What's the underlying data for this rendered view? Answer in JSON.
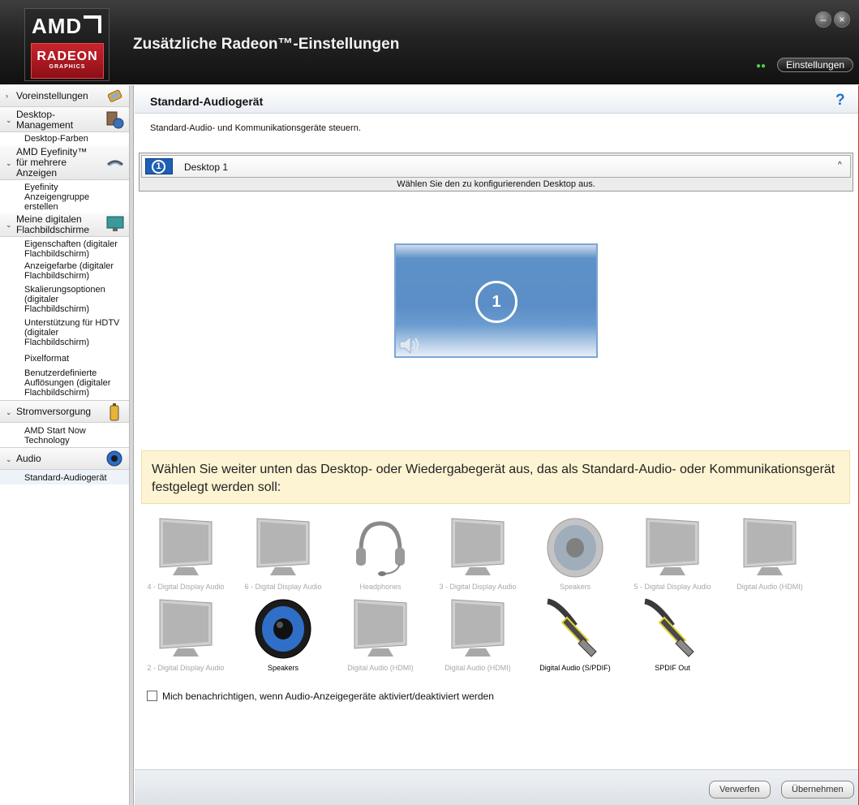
{
  "header": {
    "logo": {
      "brand": "AMD",
      "product": "RADEON",
      "subtitle": "GRAPHICS"
    },
    "title": "Zusätzliche Radeon™-Einstellungen",
    "minimize_icon": "–",
    "close_icon": "×",
    "settings_button": "Einstellungen",
    "status_led_icon": "●●"
  },
  "sidebar": {
    "sections": [
      {
        "label": "Voreinstellungen",
        "chevron": "›",
        "icon": "wrench-icon"
      },
      {
        "label": "Desktop-\nManagement",
        "chevron": "⌄",
        "icon": "monitor-gear-icon",
        "items": [
          "Desktop-Farben"
        ]
      },
      {
        "label": "AMD Eyefinity™\nfür mehrere\nAnzeigen",
        "chevron": "⌄",
        "icon": "eyefinity-icon",
        "items": [
          "Eyefinity\nAnzeigengruppe\nerstellen"
        ]
      },
      {
        "label": "Meine digitalen\nFlachbildschirme",
        "chevron": "⌄",
        "icon": "flatpanel-icon",
        "items": [
          "Eigenschaften (digitaler\nFlachbildschirm)",
          "Anzeigefarbe (digitaler\nFlachbildschirm)",
          "Skalierungsoptionen\n(digitaler\nFlachbildschirm)",
          "Unterstützung für HDTV\n(digitaler\nFlachbildschirm)",
          "Pixelformat",
          "Benutzerdefinierte\nAuflösungen (digitaler\nFlachbildschirm)"
        ]
      },
      {
        "label": "Stromversorgung",
        "chevron": "⌄",
        "icon": "battery-icon",
        "items": [
          "AMD Start Now\nTechnology"
        ]
      },
      {
        "label": "Audio",
        "chevron": "⌄",
        "icon": "speaker-icon",
        "items": [
          "Standard-Audiogerät"
        ]
      }
    ]
  },
  "page": {
    "title": "Standard-Audiogerät",
    "help": "?",
    "description": "Standard-Audio- und Kommunikationsgeräte steuern.",
    "desktop_select": {
      "number": "1",
      "label": "Desktop 1",
      "caret": "^",
      "hint": "Wählen Sie den zu konfigurierenden Desktop aus."
    },
    "desktop_tile_number": "1",
    "instruction": "Wählen Sie weiter unten das Desktop- oder Wiedergabegerät aus, das als Standard-Audio- oder Kommunikationsgerät festgelegt werden soll:",
    "devices": [
      {
        "label": "4 - Digital Display Audio",
        "type": "monitor",
        "active": false
      },
      {
        "label": "6 - Digital Display Audio",
        "type": "monitor",
        "active": false
      },
      {
        "label": "Headphones",
        "type": "headphones",
        "active": false
      },
      {
        "label": "3 - Digital Display Audio",
        "type": "monitor",
        "active": false
      },
      {
        "label": "Speakers",
        "type": "speaker",
        "active": false
      },
      {
        "label": "5 - Digital Display Audio",
        "type": "monitor",
        "active": false
      },
      {
        "label": "Digital Audio (HDMI)",
        "type": "monitor",
        "active": false
      },
      {
        "label": "2 - Digital Display Audio",
        "type": "monitor",
        "active": false
      },
      {
        "label": "Speakers",
        "type": "speaker",
        "active": true
      },
      {
        "label": "Digital Audio (HDMI)",
        "type": "monitor",
        "active": false
      },
      {
        "label": "Digital Audio (HDMI)",
        "type": "monitor",
        "active": false
      },
      {
        "label": "Digital Audio (S/PDIF)",
        "type": "cable",
        "active": true
      },
      {
        "label": "SPDIF Out",
        "type": "cable",
        "active": true
      }
    ],
    "notify_checkbox": {
      "label": "Mich benachrichtigen, wenn Audio-Anzeigegeräte aktiviert/deaktiviert werden",
      "checked": false
    }
  },
  "footer": {
    "discard": "Verwerfen",
    "apply": "Übernehmen"
  },
  "colors": {
    "accent": "#1f5fb3",
    "header_bg": "#232323",
    "logo_red": "#c8242e",
    "instruction_bg": "#fdf4d3",
    "help": "#1e73c8"
  }
}
